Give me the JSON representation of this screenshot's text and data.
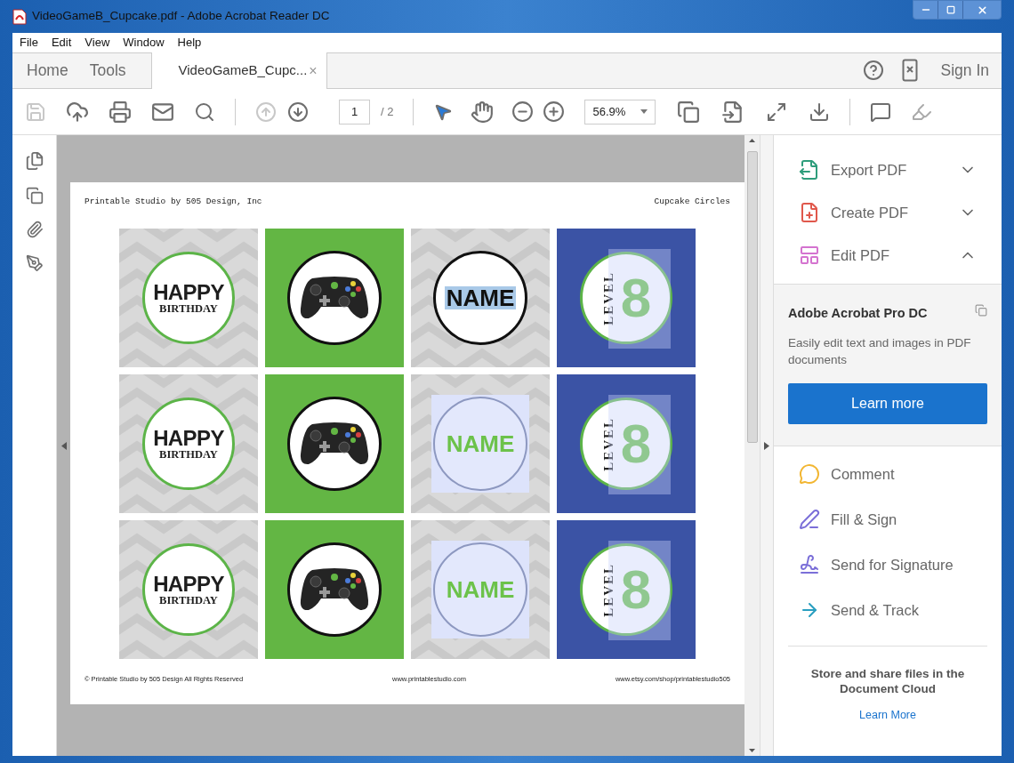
{
  "window": {
    "title": "VideoGameB_Cupcake.pdf - Adobe Acrobat Reader DC"
  },
  "menu": [
    "File",
    "Edit",
    "View",
    "Window",
    "Help"
  ],
  "tabs": [
    {
      "label": "Home",
      "kind": "nav",
      "selected": false
    },
    {
      "label": "Tools",
      "kind": "nav",
      "selected": false
    },
    {
      "label": "VideoGameB_Cupc...",
      "kind": "document",
      "selected": true,
      "close": "×"
    }
  ],
  "sign_in": "Sign In",
  "toolbar": {
    "page": "1",
    "page_total": "/ 2",
    "zoom": "56.9%"
  },
  "page": {
    "header_left": "Printable Studio by 505 Design, Inc",
    "header_right": "Cupcake Circles",
    "tiles": [
      {
        "kind": "greeting",
        "lines": [
          "HAPPY",
          "BIRTHDAY"
        ]
      },
      {
        "kind": "controller"
      },
      {
        "kind": "name",
        "text": "NAME",
        "highlighted": true
      },
      {
        "kind": "level",
        "label": "LEVEL",
        "number": "8"
      },
      {
        "kind": "greeting",
        "lines": [
          "HAPPY",
          "BIRTHDAY"
        ]
      },
      {
        "kind": "controller"
      },
      {
        "kind": "name",
        "text": "NAME",
        "highlighted": false
      },
      {
        "kind": "level",
        "label": "LEVEL",
        "number": "8"
      },
      {
        "kind": "greeting",
        "lines": [
          "HAPPY",
          "BIRTHDAY"
        ]
      },
      {
        "kind": "controller"
      },
      {
        "kind": "name",
        "text": "NAME",
        "highlighted": false
      },
      {
        "kind": "level",
        "label": "LEVEL",
        "number": "8"
      }
    ],
    "footer": [
      "© Printable Studio by 505 Design All Rights Reserved",
      "www.printablestudio.com",
      "www.etsy.com/shop/printablestudio505"
    ]
  },
  "tools_panel": {
    "tools": [
      {
        "label": "Export PDF",
        "kind": "export",
        "expanded": false
      },
      {
        "label": "Create PDF",
        "kind": "create",
        "expanded": false
      },
      {
        "label": "Edit PDF",
        "kind": "edit",
        "expanded": true
      }
    ],
    "promo": {
      "title": "Adobe Acrobat Pro DC",
      "text": "Easily edit text and images in PDF documents",
      "button": "Learn more"
    },
    "more_tools": [
      {
        "label": "Comment",
        "kind": "comment"
      },
      {
        "label": "Fill & Sign",
        "kind": "fill"
      },
      {
        "label": "Send for Signature",
        "kind": "signature"
      },
      {
        "label": "Send & Track",
        "kind": "track"
      }
    ],
    "cloud": {
      "text": "Store and share files in the Document Cloud",
      "link": "Learn More"
    }
  }
}
